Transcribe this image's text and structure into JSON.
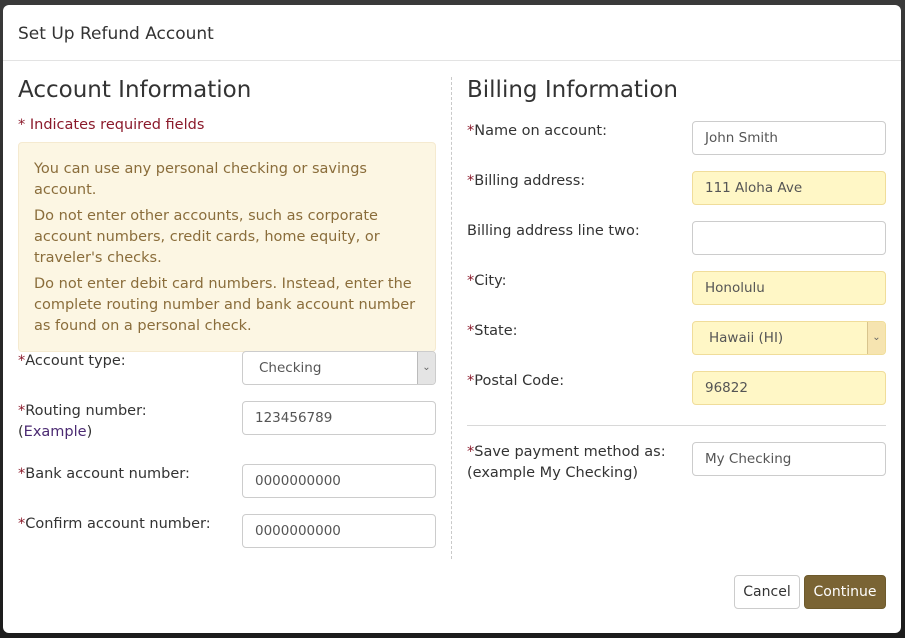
{
  "dialog": {
    "title": "Set Up Refund Account"
  },
  "account_info": {
    "heading": "Account Information",
    "required_note": "* Indicates required fields",
    "notice": [
      "You can use any personal checking or savings account.",
      "Do not enter other accounts, such as corporate account numbers, credit cards, home equity, or traveler's checks.",
      "Do not enter debit card numbers. Instead, enter the complete routing number and bank account number as found on a personal check."
    ],
    "account_type": {
      "label": "Account type:",
      "value": "Checking"
    },
    "routing_number": {
      "label": "Routing number:",
      "example_link": "Example",
      "value": "123456789"
    },
    "bank_account_number": {
      "label": "Bank account number:",
      "value": "0000000000"
    },
    "confirm_account_number": {
      "label": "Confirm account number:",
      "value": "0000000000"
    }
  },
  "billing_info": {
    "heading": "Billing Information",
    "name_on_account": {
      "label": "Name on account:",
      "value": "John Smith"
    },
    "billing_address": {
      "label": "Billing address:",
      "value": "111 Aloha Ave"
    },
    "billing_address_2": {
      "label": "Billing address line two:",
      "value": ""
    },
    "city": {
      "label": "City:",
      "value": "Honolulu"
    },
    "state": {
      "label": "State:",
      "value": "Hawaii (HI)"
    },
    "postal_code": {
      "label": "Postal Code:",
      "value": "96822"
    },
    "save_as": {
      "label": "Save payment method as:",
      "hint": "(example My Checking)",
      "value": "My Checking"
    }
  },
  "required_marker": "*",
  "footer": {
    "cancel_label": "Cancel",
    "continue_label": "Continue"
  },
  "colors": {
    "accent": "#7a6434",
    "required": "#8b1a2b",
    "warning_bg": "#fcf6e3",
    "autofill_bg": "#fff7c6"
  }
}
